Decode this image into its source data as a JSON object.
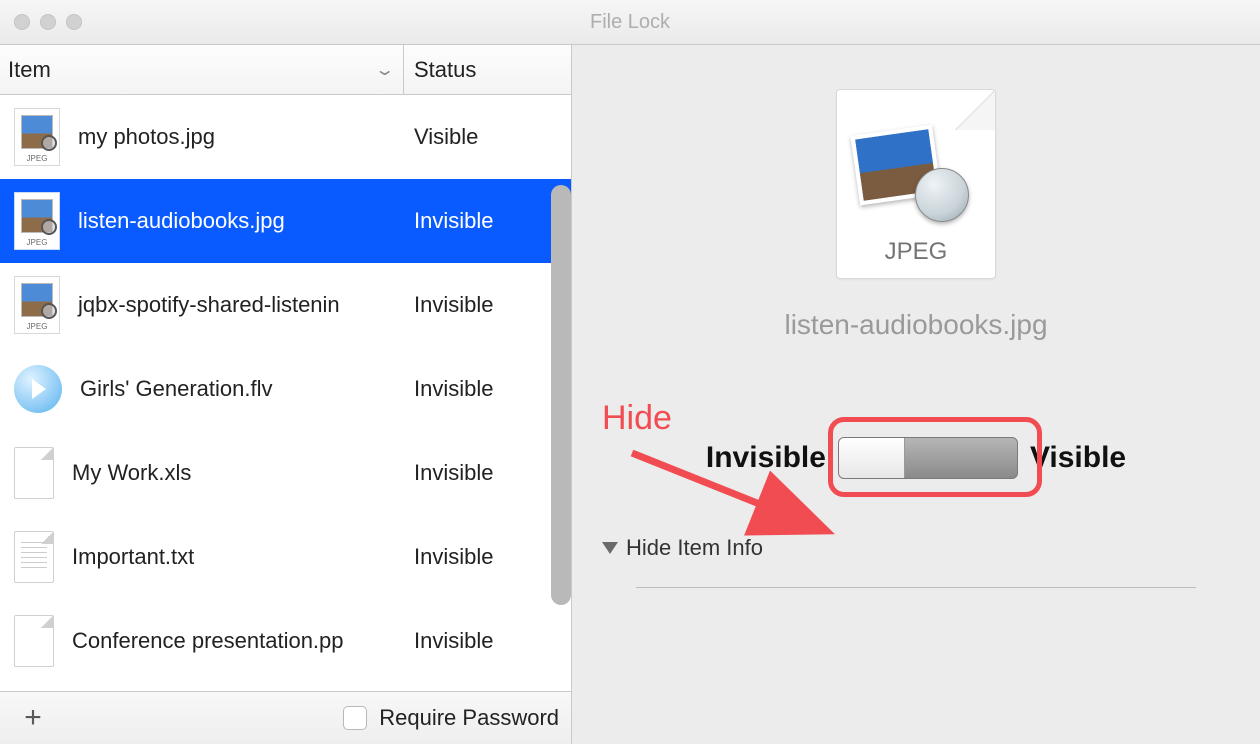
{
  "window": {
    "title": "File Lock"
  },
  "columns": {
    "item": "Item",
    "status": "Status"
  },
  "files": [
    {
      "name": "my photos.jpg",
      "status": "Visible",
      "icon": "jpeg",
      "selected": false
    },
    {
      "name": "listen-audiobooks.jpg",
      "status": "Invisible",
      "icon": "jpeg",
      "selected": true
    },
    {
      "name": "jqbx-spotify-shared-listenin",
      "status": "Invisible",
      "icon": "jpeg",
      "selected": false
    },
    {
      "name": "Girls' Generation.flv",
      "status": "Invisible",
      "icon": "flv",
      "selected": false
    },
    {
      "name": "My Work.xls",
      "status": "Invisible",
      "icon": "doc",
      "selected": false
    },
    {
      "name": "Important.txt",
      "status": "Invisible",
      "icon": "txt",
      "selected": false
    },
    {
      "name": "Conference presentation.pp",
      "status": "Invisible",
      "icon": "doc",
      "selected": false
    }
  ],
  "footer": {
    "require_password": "Require Password"
  },
  "preview": {
    "badge": "JPEG",
    "filename": "listen-audiobooks.jpg",
    "invisible_label": "Invisible",
    "visible_label": "Visible",
    "hide_info": "Hide Item Info"
  },
  "annotation": {
    "hide_label": "Hide"
  }
}
